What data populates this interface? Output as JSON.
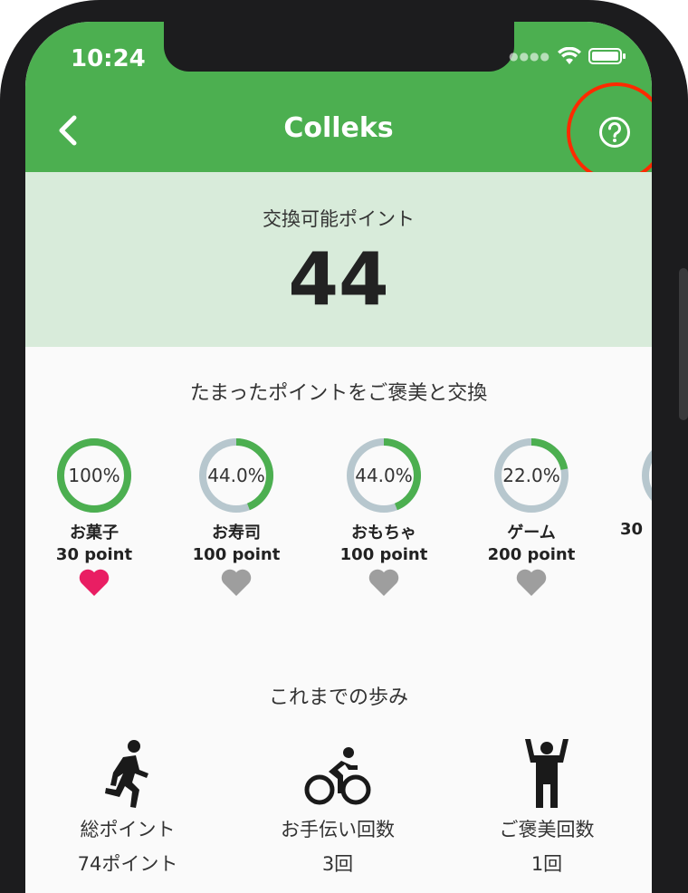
{
  "status_bar": {
    "time": "10:24"
  },
  "header": {
    "title": "Colleks"
  },
  "points": {
    "label": "交換可能ポイント",
    "value": "44"
  },
  "rewards_section": {
    "title": "たまったポイントをご褒美と交換",
    "items": [
      {
        "percent": "100%",
        "progress": 1.0,
        "name": "お菓子",
        "points": "30 point",
        "favorited": true
      },
      {
        "percent": "44.0%",
        "progress": 0.44,
        "name": "お寿司",
        "points": "100 point",
        "favorited": false
      },
      {
        "percent": "44.0%",
        "progress": 0.44,
        "name": "おもちゃ",
        "points": "100 point",
        "favorited": false
      },
      {
        "percent": "22.0%",
        "progress": 0.22,
        "name": "ゲーム",
        "points": "200 point",
        "favorited": false
      },
      {
        "percent": "",
        "progress": 0.0,
        "name": "",
        "points": "30",
        "favorited": false
      }
    ]
  },
  "history_section": {
    "title": "これまでの歩み",
    "stats": [
      {
        "icon": "running-icon",
        "label": "総ポイント",
        "value": "74ポイント"
      },
      {
        "icon": "cycling-icon",
        "label": "お手伝い回数",
        "value": "3回"
      },
      {
        "icon": "cheering-person-icon",
        "label": "ご褒美回数",
        "value": "1回"
      }
    ]
  },
  "colors": {
    "header": "#4caf50",
    "points_card": "#d8ebda",
    "progress": "#4caf50",
    "track": "#b7c7ce",
    "heart_active": "#e91e63",
    "heart_inactive": "#9e9e9e",
    "highlight_ring": "#ff2a00"
  }
}
